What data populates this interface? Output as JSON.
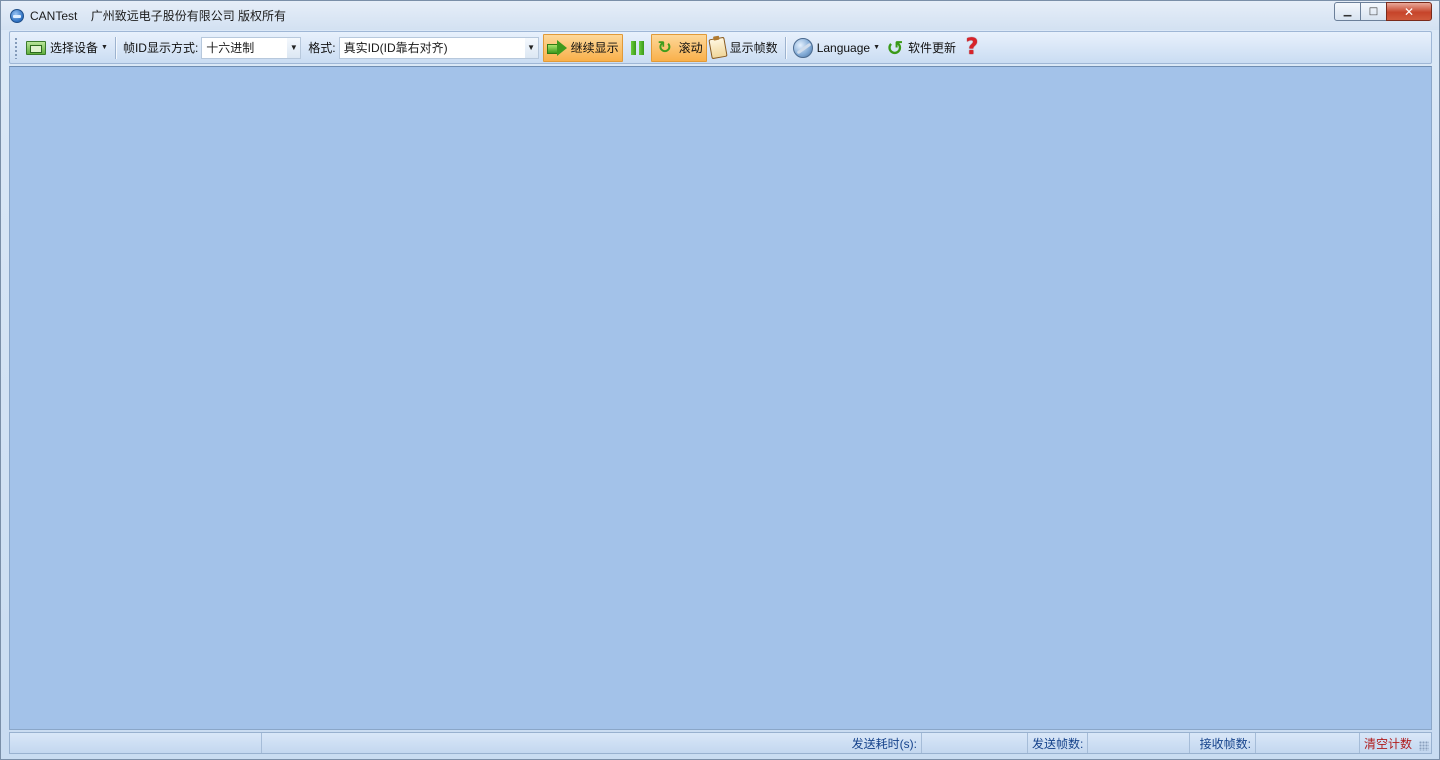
{
  "window": {
    "app_name": "CANTest",
    "copyright": "广州致远电子股份有限公司 版权所有",
    "minimize_glyph": "▁",
    "maximize_glyph": "□",
    "close_glyph": "✕"
  },
  "toolbar": {
    "select_device_label": "选择设备",
    "select_device_icon": "device-card-icon",
    "frame_id_display_label": "帧ID显示方式:",
    "frame_id_display_value": "十六进制",
    "format_label": "格式:",
    "format_value": "真实ID(ID靠右对齐)",
    "continue_display_label": "继续显示",
    "scroll_label": "滚动",
    "scroll_glyph": "↻",
    "show_frame_count_label": "显示帧数",
    "language_label": "Language",
    "software_update_label": "软件更新",
    "update_glyph": "↺",
    "help_glyph": "?",
    "active_color": "#f9b04a"
  },
  "content": {
    "background_color": "#a3c2e9"
  },
  "statusbar": {
    "send_time_label": "发送耗时(s):",
    "send_time_value": "",
    "send_frames_label": "发送帧数:",
    "send_frames_value": "",
    "recv_frames_label": "接收帧数:",
    "recv_frames_value": "",
    "clear_count_label": "清空计数"
  }
}
